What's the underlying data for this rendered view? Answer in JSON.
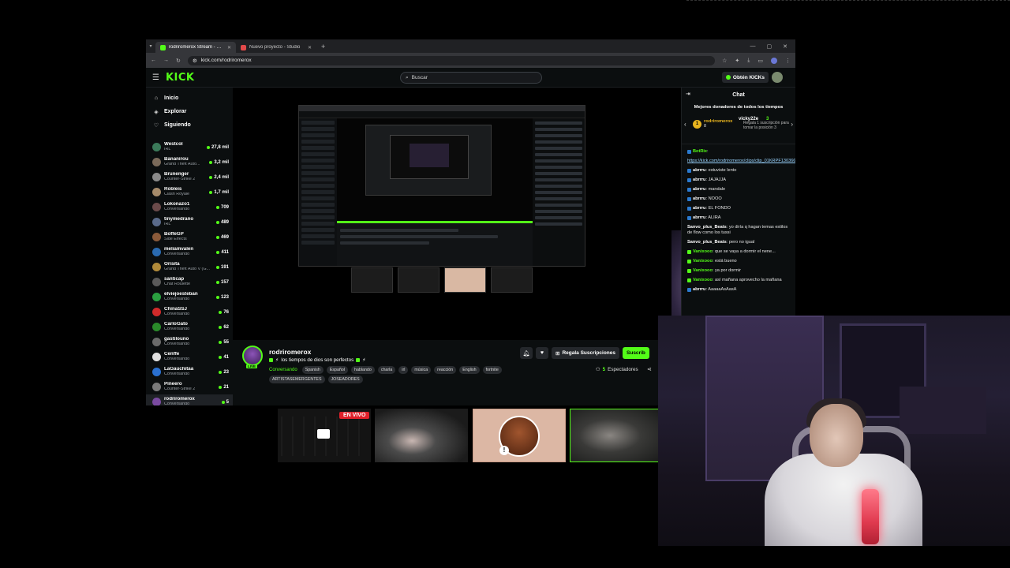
{
  "browser": {
    "tabs": [
      {
        "label": "rodriromerox Stream - Watch",
        "active": true,
        "fav_color": "#53fc18"
      },
      {
        "label": "Nuevo proyecto - Studio",
        "active": false,
        "fav_color": "#e24a4a"
      }
    ],
    "url": "kick.com/rodriromerox"
  },
  "header": {
    "logo": "KICK",
    "search_placeholder": "Buscar",
    "get_kicks": "Obtén KICKs"
  },
  "nav": [
    {
      "label": "Inicio",
      "icon": "⌂"
    },
    {
      "label": "Explorar",
      "icon": "◈"
    },
    {
      "label": "Siguiendo",
      "icon": "♡"
    }
  ],
  "channels": [
    {
      "name": "Westcol",
      "category": "IRL",
      "viewers": "27,8 mil",
      "color": "#3b7a5a"
    },
    {
      "name": "Bananirou",
      "category": "Grand Theft Auto...",
      "viewers": "3,2 mil",
      "color": "#7a6a5a"
    },
    {
      "name": "Brunenger",
      "category": "Counter-Strike 2",
      "viewers": "2,4 mil",
      "color": "#8a8a8a"
    },
    {
      "name": "Robleis",
      "category": "Clash Royale",
      "viewers": "1,7 mil",
      "color": "#a58a6a"
    },
    {
      "name": "Lokonazo1",
      "category": "Conversando",
      "viewers": "709",
      "color": "#6a4a4a"
    },
    {
      "name": "tinymedrano",
      "category": "IRL",
      "viewers": "489",
      "color": "#5a6a8a"
    },
    {
      "name": "BoffeGP",
      "category": "Side Effects",
      "viewers": "469",
      "color": "#8a5a3a"
    },
    {
      "name": "meliamvalen",
      "category": "Conversando",
      "viewers": "411",
      "color": "#2a6ab0"
    },
    {
      "name": "Orisita",
      "category": "Grand Theft Auto V (G...",
      "viewers": "191",
      "color": "#b08a3a"
    },
    {
      "name": "santicap",
      "category": "Chat Roulette",
      "viewers": "157",
      "color": "#5a5a5a"
    },
    {
      "name": "elviejoesteban",
      "category": "Conversando",
      "viewers": "123",
      "color": "#2aa040"
    },
    {
      "name": "ChinaSSJ",
      "category": "Conversando",
      "viewers": "76",
      "color": "#d02a2a"
    },
    {
      "name": "CarloGato",
      "category": "Conversando",
      "viewers": "62",
      "color": "#2a8a2a"
    },
    {
      "name": "gastilouno",
      "category": "Conversando",
      "viewers": "55",
      "color": "#6a6a6a"
    },
    {
      "name": "Cenffe",
      "category": "Conversando",
      "viewers": "41",
      "color": "#e0e0e0"
    },
    {
      "name": "LaGauchitaa",
      "category": "Conversando",
      "viewers": "23",
      "color": "#2a70d0"
    },
    {
      "name": "Pineero",
      "category": "Counter-Strike 2",
      "viewers": "21",
      "color": "#7a7a7a"
    },
    {
      "name": "rodriromerox",
      "category": "Conversando",
      "viewers": "5",
      "color": "#7a4aa0"
    }
  ],
  "stream": {
    "name": "rodriromerox",
    "title": "los tiempos de dios son perfectos",
    "category": "Conversando",
    "tags": [
      "Spanish",
      "Español",
      "hablando",
      "charla",
      "irl",
      "música",
      "reacción",
      "English",
      "fortnite"
    ],
    "tags2": [
      "ARTISTASEMERGENTES",
      "JOSEADORES"
    ],
    "live_badge": "LIVE",
    "gift_label": "Regala Suscripciones",
    "subscribe_label": "Suscrib",
    "viewers_count": "5",
    "viewers_label": "Espectadores"
  },
  "chat": {
    "title": "Chat",
    "donors_title": "Mejores donadores de todos los tiempos",
    "donor1": {
      "rank": "1",
      "name": "rodriromerox",
      "value": "8"
    },
    "donor2": {
      "name": "vicky22e",
      "value": "3",
      "sub": "Regala 1 suscripción para tomar la posición 3"
    },
    "messages": [
      {
        "user": "BotRix",
        "text": "",
        "color": "#53fc18",
        "badge": "#2a7ad0"
      },
      {
        "user": "",
        "text": "https://kick.com/rodriromerox/clips/clip_01KRPF13036682V3Y7X55JWHKY",
        "color": "#53fc18",
        "badge": "",
        "link": true
      },
      {
        "user": "abrrru",
        "text": "estuviste lento",
        "color": "#ffffff",
        "badge": "#2a7ad0"
      },
      {
        "user": "abrrru",
        "text": "JAJAJJA",
        "color": "#ffffff",
        "badge": "#2a7ad0"
      },
      {
        "user": "abrrru",
        "text": "mandale",
        "color": "#ffffff",
        "badge": "#2a7ad0"
      },
      {
        "user": "abrrru",
        "text": "NOOO",
        "color": "#ffffff",
        "badge": "#2a7ad0"
      },
      {
        "user": "abrrru",
        "text": "EL FONDO",
        "color": "#ffffff",
        "badge": "#2a7ad0"
      },
      {
        "user": "abrrru",
        "text": "ALIRA",
        "color": "#ffffff",
        "badge": "#2a7ad0"
      },
      {
        "user": "Sanvo_plus_Beats",
        "text": "yo diría q hagan temas estilos de flow como los tussi",
        "color": "#ffffff",
        "badge": ""
      },
      {
        "user": "Sanvo_plus_Beats",
        "text": "pero no igual",
        "color": "#ffffff",
        "badge": ""
      },
      {
        "user": "Vanixooo",
        "text": "que se vaya a dormir el nene...",
        "color": "#53fc18",
        "badge": "#53fc18"
      },
      {
        "user": "Vanixooo",
        "text": "está bueno",
        "color": "#53fc18",
        "badge": "#53fc18"
      },
      {
        "user": "Vanixooo",
        "text": "ya por dormir",
        "color": "#53fc18",
        "badge": "#53fc18"
      },
      {
        "user": "Vanixooo",
        "text": "así mañana aprovecho la mañana",
        "color": "#53fc18",
        "badge": "#53fc18"
      },
      {
        "user": "abrrru",
        "text": "AaaaaAsAasA",
        "color": "#ffffff",
        "badge": "#2a7ad0"
      }
    ]
  },
  "thumbnails": {
    "live_label": "EN VIVO"
  }
}
